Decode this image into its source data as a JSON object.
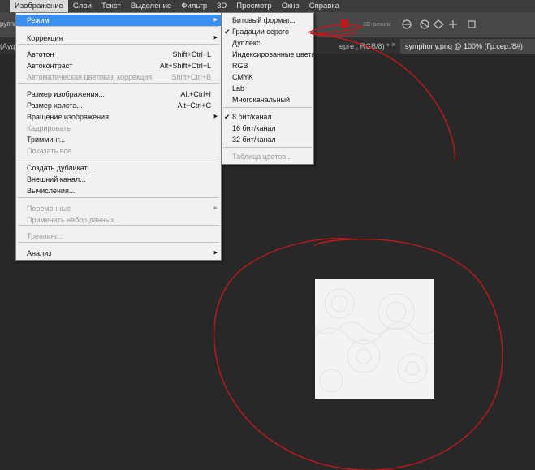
{
  "menubar": {
    "items": [
      "",
      "Изображение",
      "Слои",
      "Текст",
      "Выделение",
      "Фильтр",
      "3D",
      "Просмотр",
      "Окно",
      "Справка"
    ]
  },
  "options_bar": {
    "left_text": "руппа",
    "mode_3d_label": "3D-режим"
  },
  "tabs": [
    {
      "label": "(Ауд",
      "active": false
    },
    {
      "label": "ерге , RGB/8) *",
      "active": false
    },
    {
      "label": "symphony.png @ 100% (Гр.сер./8#)",
      "active": true
    }
  ],
  "image_menu": {
    "items": [
      {
        "label": "Режим",
        "shortcut": "",
        "submenu": true,
        "disabled": false,
        "highlighted": true
      },
      {
        "label": "Коррекция",
        "shortcut": "",
        "submenu": true,
        "disabled": false
      },
      {
        "label": "Автотон",
        "shortcut": "Shift+Ctrl+L",
        "disabled": false
      },
      {
        "label": "Автоконтраст",
        "shortcut": "Alt+Shift+Ctrl+L",
        "disabled": false
      },
      {
        "label": "Автоматическая цветовая коррекция",
        "shortcut": "Shift+Ctrl+B",
        "disabled": true
      },
      {
        "label": "Размер изображения...",
        "shortcut": "Alt+Ctrl+I",
        "disabled": false
      },
      {
        "label": "Размер холста...",
        "shortcut": "Alt+Ctrl+C",
        "disabled": false
      },
      {
        "label": "Вращение изображения",
        "shortcut": "",
        "submenu": true,
        "disabled": false
      },
      {
        "label": "Кадрировать",
        "shortcut": "",
        "disabled": true
      },
      {
        "label": "Тримминг...",
        "shortcut": "",
        "disabled": false
      },
      {
        "label": "Показать все",
        "shortcut": "",
        "disabled": true
      },
      {
        "label": "Создать дубликат...",
        "shortcut": "",
        "disabled": false
      },
      {
        "label": "Внешний канал...",
        "shortcut": "",
        "disabled": false
      },
      {
        "label": "Вычисления...",
        "shortcut": "",
        "disabled": false
      },
      {
        "label": "Переменные",
        "shortcut": "",
        "submenu": true,
        "disabled": true
      },
      {
        "label": "Применить набор данных...",
        "shortcut": "",
        "disabled": true
      },
      {
        "label": "Треппинг...",
        "shortcut": "",
        "disabled": true
      },
      {
        "label": "Анализ",
        "shortcut": "",
        "submenu": true,
        "disabled": false
      }
    ]
  },
  "mode_submenu": {
    "items": [
      {
        "label": "Битовый формат...",
        "checked": false,
        "disabled": false
      },
      {
        "label": "Градации серого",
        "checked": true,
        "disabled": false
      },
      {
        "label": "Дуплекс...",
        "checked": false,
        "disabled": false
      },
      {
        "label": "Индексированные цвета",
        "checked": false,
        "disabled": false
      },
      {
        "label": "RGB",
        "checked": false,
        "disabled": false
      },
      {
        "label": "CMYK",
        "checked": false,
        "disabled": false
      },
      {
        "label": "Lab",
        "checked": false,
        "disabled": false
      },
      {
        "label": "Многоканальный",
        "checked": false,
        "disabled": false
      },
      {
        "label": "8 бит/канал",
        "checked": true,
        "disabled": false
      },
      {
        "label": "16 бит/канал",
        "checked": false,
        "disabled": false
      },
      {
        "label": "32 бит/канал",
        "checked": false,
        "disabled": false
      },
      {
        "label": "Таблица цветов...",
        "checked": false,
        "disabled": true
      }
    ]
  },
  "colors": {
    "highlight": "#3b8ff0",
    "annotation": "#c0191b",
    "menu_bg": "#f1f1f1"
  },
  "icons": [
    "checkmark-icon",
    "submenu-arrow-icon",
    "3d-mode-icons",
    "tab-close-icon"
  ]
}
